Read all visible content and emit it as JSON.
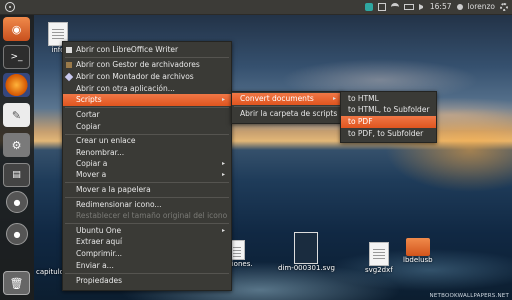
{
  "panel": {
    "time": "16:57",
    "user": "lorenzo"
  },
  "launcher": {
    "items": [
      "ubuntu-dash",
      "terminal",
      "firefox",
      "text-editor",
      "system-settings",
      "system-monitor",
      "disk",
      "disk",
      "trash"
    ]
  },
  "desktop": {
    "files": [
      {
        "label": "info"
      },
      {
        "label": "capitulo"
      },
      {
        "label": "visiones."
      },
      {
        "label": "dim-000301.svg"
      },
      {
        "label": "svg2dxf"
      },
      {
        "label": "lbdelusb"
      }
    ]
  },
  "menu_main": {
    "items": [
      {
        "label": "Abrir con LibreOffice Writer",
        "icon": "writer-icon"
      },
      {
        "label": "Abrir con Gestor de archivadores",
        "icon": "archive-icon"
      },
      {
        "label": "Abrir con Montador de archivos",
        "icon": "mount-icon"
      },
      {
        "label": "Abrir con otra aplicación..."
      },
      {
        "label": "Scripts"
      },
      {
        "label": "Cortar"
      },
      {
        "label": "Copiar"
      },
      {
        "label": "Crear un enlace"
      },
      {
        "label": "Renombrar..."
      },
      {
        "label": "Copiar a"
      },
      {
        "label": "Mover a"
      },
      {
        "label": "Mover a la papelera"
      },
      {
        "label": "Redimensionar icono..."
      },
      {
        "label": "Restablecer el tamaño original del icono"
      },
      {
        "label": "Ubuntu One"
      },
      {
        "label": "Extraer aquí"
      },
      {
        "label": "Comprimir..."
      },
      {
        "label": "Enviar a..."
      },
      {
        "label": "Propiedades"
      }
    ]
  },
  "menu_scripts": {
    "items": [
      {
        "label": "Convert documents"
      },
      {
        "label": "Abrir la carpeta de scripts"
      }
    ]
  },
  "menu_convert": {
    "items": [
      {
        "label": "to HTML"
      },
      {
        "label": "to HTML, to Subfolder"
      },
      {
        "label": "to PDF"
      },
      {
        "label": "to PDF, to Subfolder"
      }
    ]
  },
  "watermark": "NETBOOKWALLPAPERS.NET",
  "colors": {
    "highlight": "#e8632b",
    "menu_bg": "#3a3a36",
    "panel_bg": "#3c3b37"
  }
}
